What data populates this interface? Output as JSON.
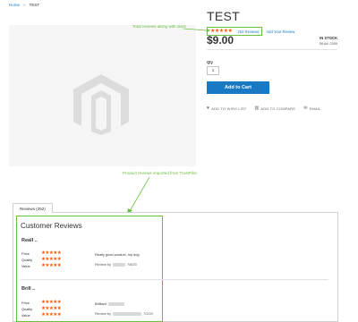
{
  "breadcrumb": {
    "home": "Home",
    "separator": ">",
    "current": "TEST"
  },
  "product": {
    "title": "TEST",
    "rating_stars": "★★★★★",
    "review_count_link": "252  Reviews",
    "add_review_link": "Add Your Review",
    "price": "$9.00",
    "stock": "IN STOCK",
    "sku": "SKU#: 2309"
  },
  "purchase": {
    "qty_label": "Qty",
    "qty_value": "1",
    "add_to_cart": "Add to Cart"
  },
  "actions": {
    "wish_icon": "heart-icon",
    "wish_label": "ADD TO WISH LIST",
    "compare_icon": "chart-icon",
    "compare_label": "ADD TO COMPARE",
    "email_icon": "envelope-icon",
    "email_label": "EMAIL"
  },
  "annotations": {
    "total_reviews": "Total reviews along with stars",
    "imported": "Product reviews imported from TrustPilot"
  },
  "tabs": {
    "reviews_tab": "Reviews (252)"
  },
  "reviews": {
    "heading": "Customer Reviews",
    "items": [
      {
        "summary": "Reall ..",
        "ratings": [
          {
            "label": "Price",
            "stars": "★★★★★"
          },
          {
            "label": "Quality",
            "stars": "★★★★★"
          },
          {
            "label": "Value",
            "stars": "★★★★★"
          }
        ],
        "body": "Really good product, my dog",
        "review_by": "Review by",
        "date": "7/8/20"
      },
      {
        "summary": "Brill ..",
        "ratings": [
          {
            "label": "Price",
            "stars": "★★★★★"
          },
          {
            "label": "Quality",
            "stars": "★★★★★"
          },
          {
            "label": "Value",
            "stars": "★★★★★"
          }
        ],
        "body": "Brilliant",
        "review_by": "Review by",
        "date": "7/2/20"
      }
    ]
  },
  "colors": {
    "accent": "#1979c3",
    "stars": "#ff5501",
    "annotation": "#6abf40"
  }
}
